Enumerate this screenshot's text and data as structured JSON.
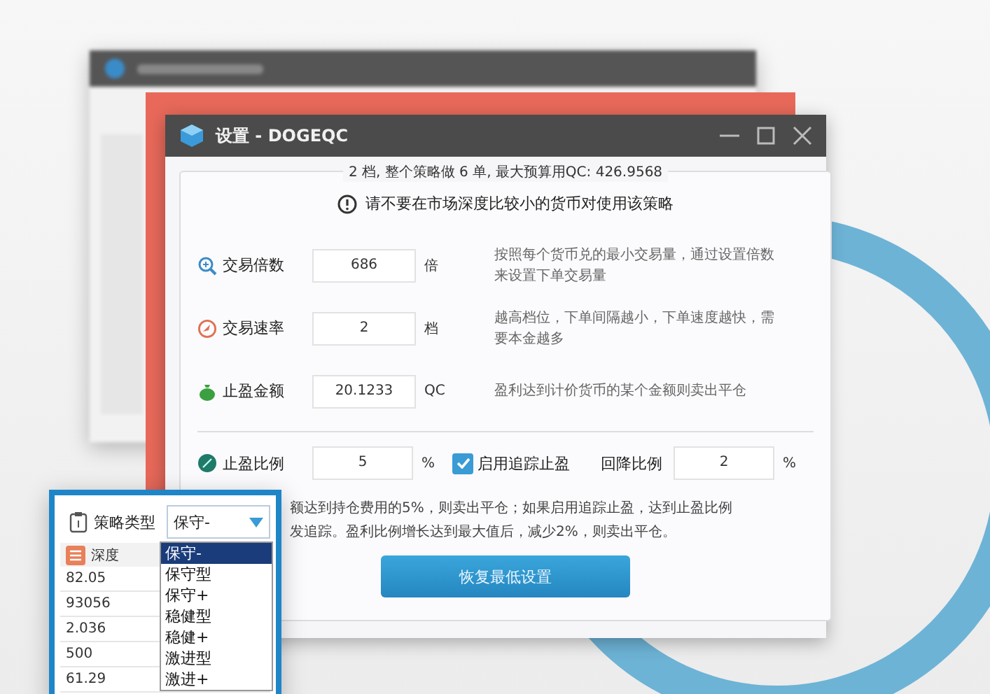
{
  "main_window": {
    "title": "设置 - DOGEQC",
    "summary": "2 档, 整个策略做 6 单, 最大预算用QC: 426.9568",
    "warning": "请不要在市场深度比较小的货币对使用该策略",
    "rows": [
      {
        "kind": "zoom",
        "label": "交易倍数",
        "value": "686",
        "unit": "倍",
        "description": "按照每个货币兑的最小交易量，通过设置倍数来设置下单交易量"
      },
      {
        "kind": "gauge",
        "label": "交易速率",
        "value": "2",
        "unit": "档",
        "description": "越高档位，下单间隔越小，下单速度越快，需要本金越多"
      },
      {
        "kind": "bag",
        "label": "止盈金额",
        "value": "20.1233",
        "unit": "QC",
        "description": "盈利达到计价货币的某个金额则卖出平仓"
      }
    ],
    "ratio": {
      "label": "止盈比例",
      "value": "5",
      "unit": "%"
    },
    "trailing": {
      "label": "启用追踪止盈",
      "checked": true
    },
    "fallback": {
      "label": "回降比例",
      "value": "2",
      "unit": "%"
    },
    "note_lines": [
      "额达到持仓费用的5%，则卖出平仓；如果启用追踪止盈，达到止盈比例",
      "发追踪。盈利比例增长达到最大值后，减少2%，则卖出平仓。"
    ],
    "button": "恢复最低设置"
  },
  "popup": {
    "label": "策略类型",
    "dropdown_value": "保守-",
    "options": [
      {
        "label": "保守-",
        "selected": true
      },
      {
        "label": "保守型",
        "selected": false
      },
      {
        "label": "保守+",
        "selected": false
      },
      {
        "label": "稳健型",
        "selected": false
      },
      {
        "label": "稳健+",
        "selected": false
      },
      {
        "label": "激进型",
        "selected": false
      },
      {
        "label": "激进+",
        "selected": false
      }
    ],
    "column_1": "深度",
    "rows": [
      "82.05",
      "93056",
      "2.036",
      "500",
      "61.29"
    ]
  }
}
